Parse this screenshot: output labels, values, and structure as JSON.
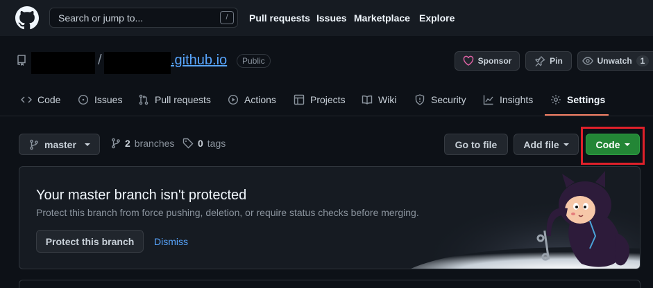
{
  "header": {
    "search_placeholder": "Search or jump to...",
    "search_shortcut": "/",
    "nav": [
      "Pull requests",
      "Issues",
      "Marketplace",
      "Explore"
    ]
  },
  "repo": {
    "separator": "/",
    "name": ".github.io",
    "visibility": "Public",
    "sponsor_label": "Sponsor",
    "pin_label": "Pin",
    "unwatch_label": "Unwatch",
    "watch_count": "1"
  },
  "tabs": [
    {
      "label": "Code",
      "icon": "code-icon"
    },
    {
      "label": "Issues",
      "icon": "issue-icon"
    },
    {
      "label": "Pull requests",
      "icon": "pull-request-icon"
    },
    {
      "label": "Actions",
      "icon": "play-icon"
    },
    {
      "label": "Projects",
      "icon": "table-icon"
    },
    {
      "label": "Wiki",
      "icon": "book-icon"
    },
    {
      "label": "Security",
      "icon": "shield-icon"
    },
    {
      "label": "Insights",
      "icon": "graph-icon"
    },
    {
      "label": "Settings",
      "icon": "gear-icon",
      "active": true
    }
  ],
  "branchbar": {
    "branch": "master",
    "branches_count": "2",
    "branches_label": "branches",
    "tags_count": "0",
    "tags_label": "tags",
    "go_to_file": "Go to file",
    "add_file": "Add file",
    "code": "Code"
  },
  "banner": {
    "title": "Your master branch isn't protected",
    "description": "Protect this branch from force pushing, deletion, or require status checks before merging.",
    "protect_button": "Protect this branch",
    "dismiss": "Dismiss"
  },
  "colors": {
    "background": "#0d1117",
    "header": "#161b22",
    "accent_link": "#58a6ff",
    "code_button": "#238636",
    "highlight_box": "#e0202a",
    "active_tab_underline": "#f78166"
  }
}
